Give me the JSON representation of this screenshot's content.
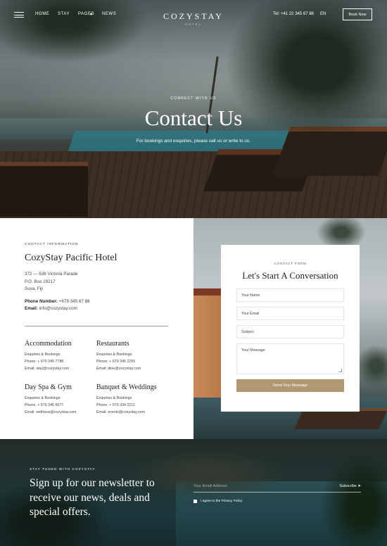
{
  "nav": {
    "items": [
      "HOME",
      "STAY",
      "PAGES",
      "NEWS"
    ],
    "brand": "COZYSTAY",
    "brand_sub": "HOTEL",
    "phone": "Tel: +41 22 345 67 88",
    "lang": "EN",
    "book_label": "Book Now"
  },
  "hero": {
    "kicker": "CONNECT WITH US",
    "title": "Contact Us",
    "subtitle": "For bookings and enquiries, please call us or write to us."
  },
  "info": {
    "kicker": "CONTACT INFORMATION",
    "hotel": "CozyStay Pacific Hotel",
    "address": [
      "372 — 636 Victoria Parade",
      "P.O. Box 19217",
      "Suva, Fiji"
    ],
    "phone_label": "Phone Number:",
    "phone_value": "+679 345 67 88",
    "email_label": "Email:",
    "email_value": "info@cozystay.com",
    "departments": [
      {
        "title": "Accommodation",
        "line1": "Enquiries & Bookings",
        "phone": "Phone: + 679 345 7788",
        "email": "Email: stay@cozystay.com"
      },
      {
        "title": "Restaurants",
        "line1": "Enquiries & Bookings",
        "phone": "Phone: + 679 345 2255",
        "email": "Email: dine@cozystay.com"
      },
      {
        "title": "Day Spa & Gym",
        "line1": "Enquiries & Bookings",
        "phone": "Phone: + 679 345 6677",
        "email": "Email: wellness@cozystay.com"
      },
      {
        "title": "Banquet & Weddings",
        "line1": "Enquiries & Bookings",
        "phone": "Phone: + 679 334 2211",
        "email": "Email: events@cozystay.com"
      }
    ]
  },
  "form": {
    "kicker": "CONTACT FORM",
    "title": "Let's Start A Conversation",
    "name_placeholder": "Your Name",
    "email_placeholder": "Your Email",
    "subject_placeholder": "Subject",
    "message_placeholder": "Your Message",
    "send_label": "Send Your Message"
  },
  "newsletter": {
    "kicker": "STAY TUNED WITH COZYSTAY",
    "title": "Sign up for our newsletter to receive our news, deals and special offers.",
    "email_placeholder": "Your Email Address",
    "subscribe_label": "Subscribe",
    "privacy_label": "I agree to the Privacy Policy"
  },
  "colors": {
    "accent": "#b09a74",
    "text": "#222222"
  },
  "icons": [
    "menu-icon",
    "send-arrow-icon"
  ]
}
